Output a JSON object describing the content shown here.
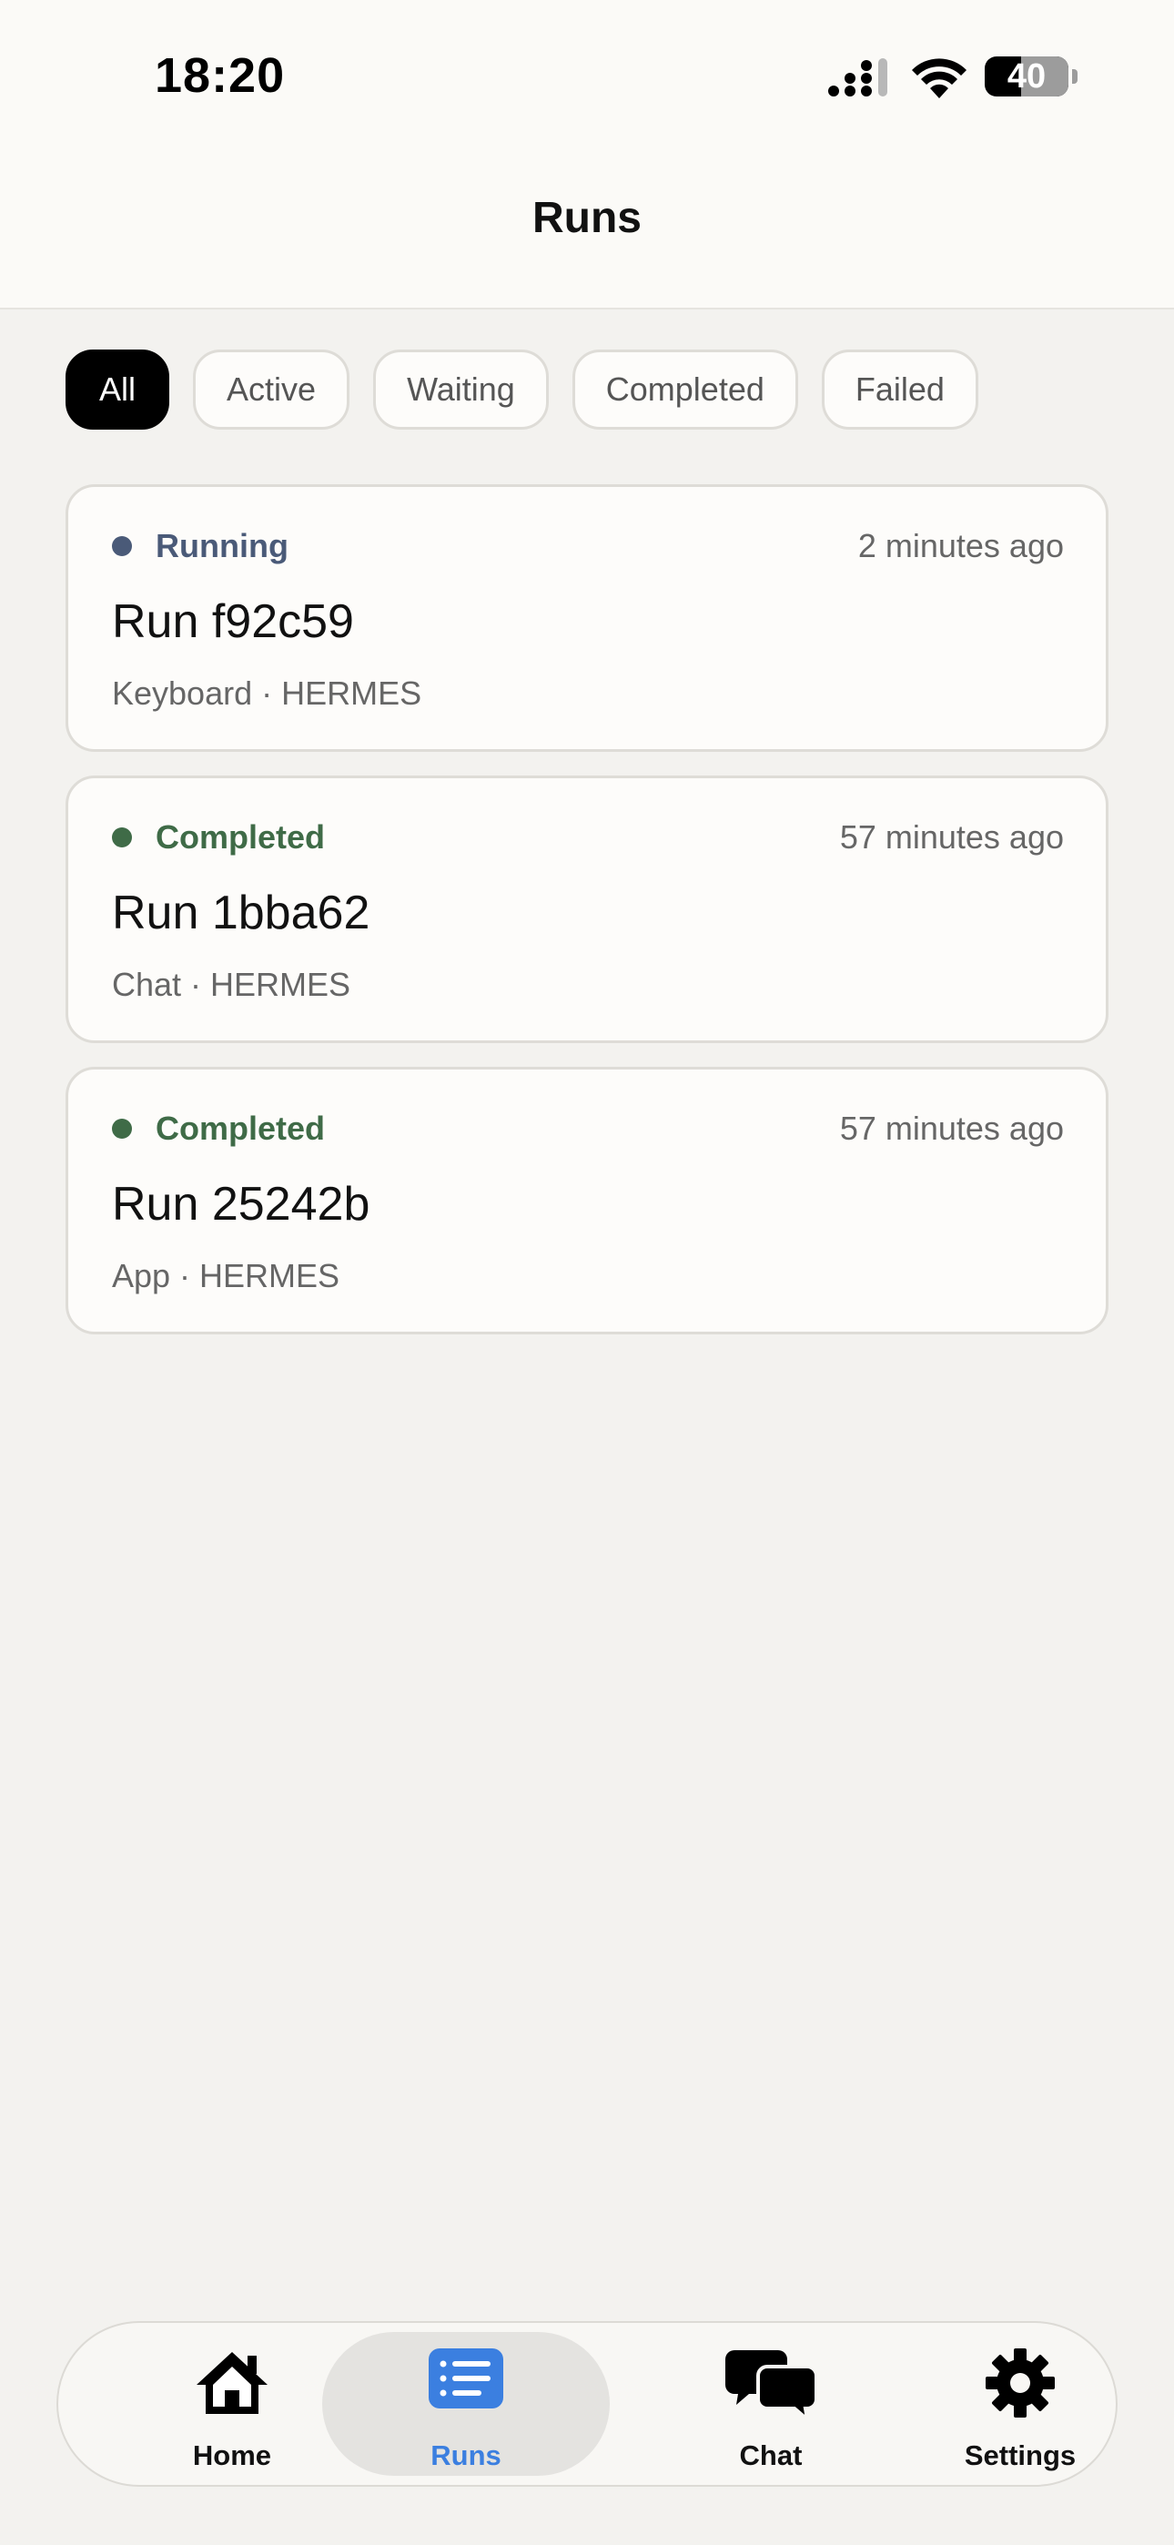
{
  "status_bar": {
    "time": "18:20",
    "battery": "40"
  },
  "header": {
    "title": "Runs"
  },
  "filters": [
    {
      "label": "All",
      "selected": true
    },
    {
      "label": "Active",
      "selected": false
    },
    {
      "label": "Waiting",
      "selected": false
    },
    {
      "label": "Completed",
      "selected": false
    },
    {
      "label": "Failed",
      "selected": false
    }
  ],
  "runs": [
    {
      "status": "Running",
      "status_color": "#4a5a78",
      "time_ago": "2 minutes ago",
      "title": "Run f92c59",
      "meta": "Keyboard · HERMES"
    },
    {
      "status": "Completed",
      "status_color": "#3f6b47",
      "time_ago": "57 minutes ago",
      "title": "Run 1bba62",
      "meta": "Chat · HERMES"
    },
    {
      "status": "Completed",
      "status_color": "#3f6b47",
      "time_ago": "57 minutes ago",
      "title": "Run 25242b",
      "meta": "App · HERMES"
    }
  ],
  "tabbar": {
    "items": [
      {
        "label": "Home",
        "icon": "home-icon"
      },
      {
        "label": "Runs",
        "icon": "runs-list-icon",
        "selected": true
      },
      {
        "label": "Chat",
        "icon": "chat-bubbles-icon"
      },
      {
        "label": "Settings",
        "icon": "gear-icon"
      }
    ],
    "accent": "#3b7fe0"
  }
}
